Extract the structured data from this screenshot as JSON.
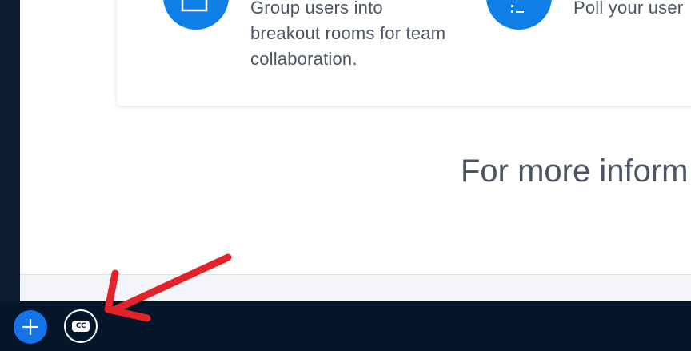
{
  "features": [
    {
      "icon": "breakout-rooms-icon",
      "lines": [
        "Group users into",
        "breakout rooms for team",
        "collaboration."
      ]
    },
    {
      "icon": "poll-icon",
      "lines": [
        "Poll your user"
      ]
    }
  ],
  "more_info_text": "For more inform",
  "toolbar": {
    "plus_icon": "plus-icon",
    "cc_label": "CC"
  },
  "colors": {
    "accent": "#0f7ee6",
    "bottom_bar": "#06162a",
    "annotation_arrow": "#e3222a",
    "body_text": "#4b5462"
  }
}
